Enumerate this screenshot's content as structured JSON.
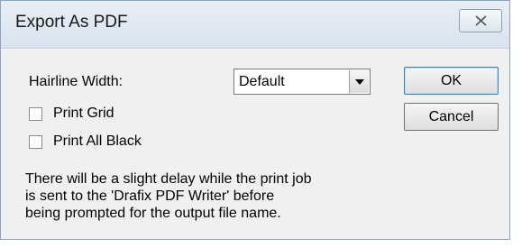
{
  "window": {
    "title": "Export As PDF",
    "close_icon": "close-icon"
  },
  "form": {
    "hairline_label": "Hairline Width:",
    "hairline_value": "Default",
    "print_grid_label": "Print Grid",
    "print_grid_checked": false,
    "print_all_black_label": "Print All Black",
    "print_all_black_checked": false
  },
  "buttons": {
    "ok_label": "OK",
    "cancel_label": "Cancel"
  },
  "note": {
    "line1": "There will be a slight delay while the print job",
    "line2": "is sent to the 'Drafix PDF Writer' before",
    "line3": "being prompted for the output file name."
  },
  "colors": {
    "dialog_bg": "#f0f0f0",
    "title_bar": "#dfe6ef",
    "default_button_border": "#3c7fb1"
  }
}
